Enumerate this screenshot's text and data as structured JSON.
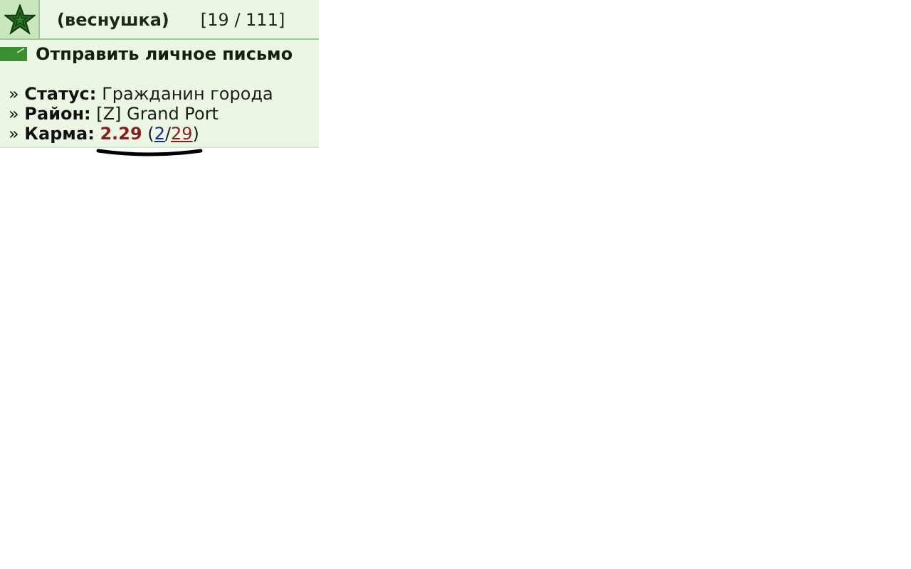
{
  "profile": {
    "name": "(веснушка)",
    "count": "[19 / 111]"
  },
  "message_link": "Отправить личное письмо",
  "info": [
    {
      "bullet": "»",
      "label": "Статус:",
      "value": "Гражданин города"
    },
    {
      "bullet": "»",
      "label": "Район:",
      "value": "[Z] Grand Port"
    }
  ],
  "karma": {
    "bullet": "»",
    "label": "Карма:",
    "value": "2.29",
    "open": "(",
    "positive": "2",
    "slash": "/",
    "negative": "29",
    "close": ")"
  }
}
